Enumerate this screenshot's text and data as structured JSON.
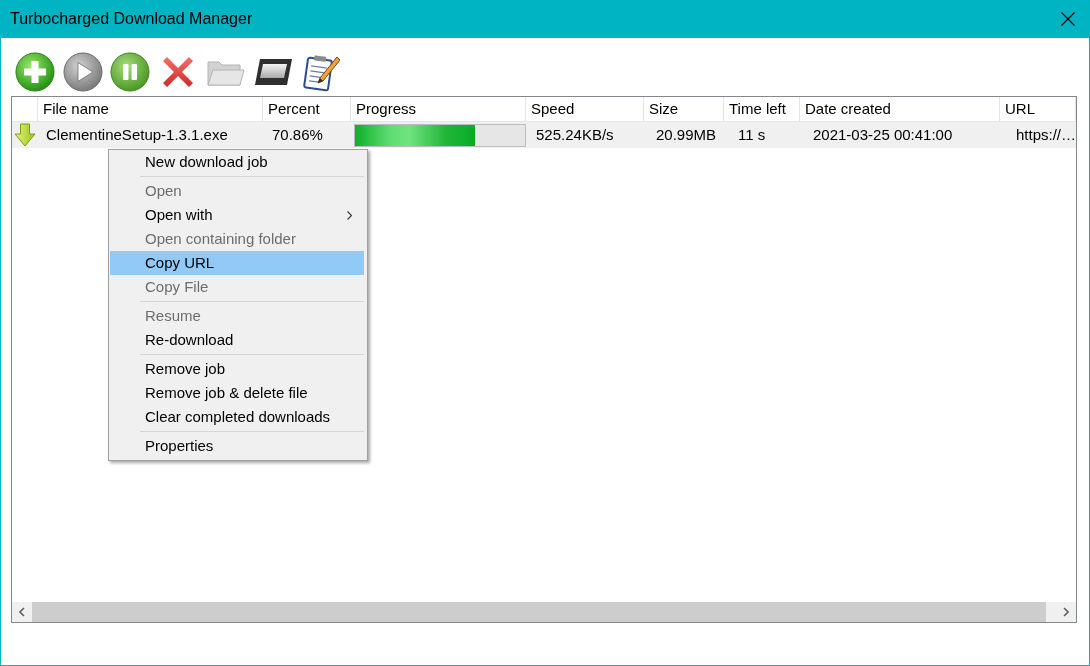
{
  "window": {
    "title": "Turbocharged Download Manager"
  },
  "toolbar": [
    {
      "kind": "add",
      "disabled": false
    },
    {
      "kind": "start",
      "disabled": true
    },
    {
      "kind": "pause",
      "disabled": false
    },
    {
      "kind": "delete",
      "disabled": false
    },
    {
      "kind": "folder",
      "disabled": true
    },
    {
      "kind": "window",
      "disabled": false
    },
    {
      "kind": "notes",
      "disabled": false
    }
  ],
  "table": {
    "columns": [
      "File name",
      "Percent",
      "Progress",
      "Speed",
      "Size",
      "Time left",
      "Date created",
      "URL"
    ],
    "rows": [
      {
        "selected": true,
        "file_name": "ClementineSetup-1.3.1.exe",
        "percent": "70.86%",
        "level": 0.7086,
        "speed": "525.24KB/s",
        "size": "20.99MB",
        "time_left": "11 s",
        "date_created": "2021-03-25 00:41:00",
        "url": "https://…"
      }
    ]
  },
  "context_menu": {
    "sections": [
      {
        "items": [
          {
            "label": "New download job",
            "disabled": false,
            "selected": false,
            "submenu": false
          }
        ]
      },
      {
        "items": [
          {
            "label": "Open",
            "disabled": true,
            "selected": false,
            "submenu": false
          },
          {
            "label": "Open with",
            "disabled": false,
            "selected": false,
            "submenu": true
          },
          {
            "label": "Open containing folder",
            "disabled": true,
            "selected": false,
            "submenu": false
          },
          {
            "label": "Copy URL",
            "disabled": false,
            "selected": true,
            "submenu": false
          },
          {
            "label": "Copy File",
            "disabled": true,
            "selected": false,
            "submenu": false
          }
        ]
      },
      {
        "items": [
          {
            "label": "Resume",
            "disabled": true,
            "selected": false,
            "submenu": false
          },
          {
            "label": "Re-download",
            "disabled": false,
            "selected": false,
            "submenu": false
          }
        ]
      },
      {
        "items": [
          {
            "label": "Remove job",
            "disabled": false,
            "selected": false,
            "submenu": false
          },
          {
            "label": "Remove job & delete file",
            "disabled": false,
            "selected": false,
            "submenu": false
          },
          {
            "label": "Clear completed downloads",
            "disabled": false,
            "selected": false,
            "submenu": false
          }
        ]
      },
      {
        "items": [
          {
            "label": "Properties",
            "disabled": false,
            "selected": false,
            "submenu": false
          }
        ]
      }
    ]
  }
}
